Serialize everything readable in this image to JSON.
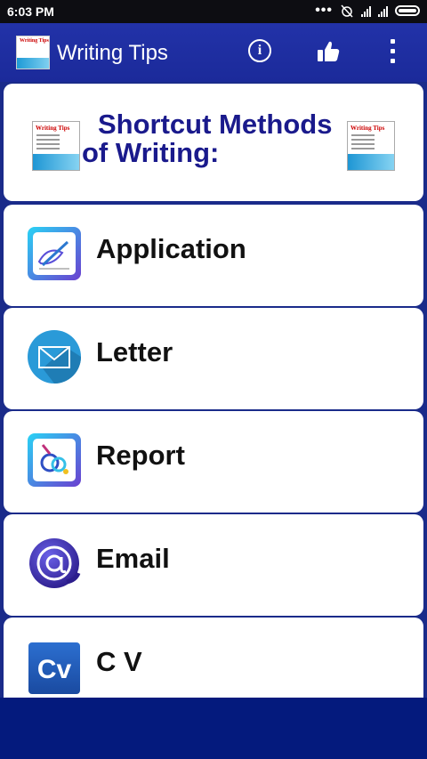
{
  "status_bar": {
    "time": "6:03 PM",
    "icons": [
      "more-dots-icon",
      "alarm-off-icon",
      "signal-icon",
      "signal-icon",
      "battery-icon"
    ]
  },
  "app_bar": {
    "title": "Writing Tips",
    "logo_text": "Writing Tips",
    "actions": [
      "info-icon",
      "thumbs-up-icon",
      "more-vert-icon"
    ]
  },
  "header": {
    "line1": "Shortcut Methods",
    "line2": "of Writing:",
    "book_text": "Writing Tips"
  },
  "items": [
    {
      "label": "Application",
      "icon": "application-icon"
    },
    {
      "label": "Letter",
      "icon": "envelope-icon"
    },
    {
      "label": "Report",
      "icon": "report-icon"
    },
    {
      "label": "Email",
      "icon": "at-sign-icon"
    },
    {
      "label": "C V",
      "icon": "cv-icon"
    }
  ],
  "colors": {
    "app_bar": "#2232a8",
    "background": "#1a2b8a",
    "header_text": "#1a1a8c",
    "status_bar": "#0d0d12"
  }
}
